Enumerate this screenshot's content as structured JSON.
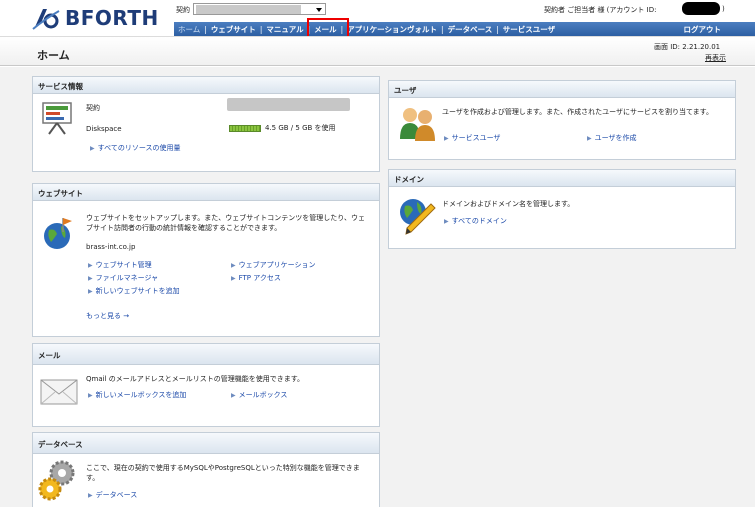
{
  "header": {
    "brand": "BFORTH",
    "contract_label": "契約",
    "account_info": "契約者 ご担当者 様 (アカウント ID:",
    "account_close": ")"
  },
  "nav": {
    "items": [
      {
        "label": "ホーム"
      },
      {
        "label": "ウェブサイト"
      },
      {
        "label": "マニュアル"
      },
      {
        "label": "メール"
      },
      {
        "label": "アプリケーションヴォルト"
      },
      {
        "label": "データベース"
      },
      {
        "label": "サービスユーザ"
      }
    ],
    "logout": "ログアウト",
    "highlighted": "メール"
  },
  "title": {
    "page_title": "ホーム",
    "screen_id": "画面 ID: 2.21.20.01",
    "redisplay": "再表示"
  },
  "service_info": {
    "heading": "サービス情報",
    "contract_label": "契約",
    "diskspace_label": "Diskspace",
    "disk_usage": "4.5 GB / 5 GB を使用",
    "link_all": "すべてのリソースの使用量"
  },
  "website": {
    "heading": "ウェブサイト",
    "desc": "ウェブサイトをセットアップします。また、ウェブサイトコンテンツを管理したり、ウェブサイト訪問者の行動の統計情報を確認することができます。",
    "domain": "brass-int.co.jp",
    "links": {
      "manage": "ウェブサイト管理",
      "filemanager": "ファイルマネージャ",
      "add_site": "新しいウェブサイトを追加",
      "webapps": "ウェブアプリケーション",
      "ftp": "FTP アクセス"
    },
    "more": "もっと見る →"
  },
  "mail": {
    "heading": "メール",
    "desc": "Qmail のメールアドレスとメールリストの管理機能を使用できます。",
    "link_add": "新しいメールボックスを追加",
    "link_box": "メールボックス"
  },
  "database": {
    "heading": "データベース",
    "desc": "ここで、現在の契約で使用するMySQLやPostgreSQLといった特別な機能を管理できます。",
    "link": "データベース"
  },
  "users": {
    "heading": "ユーザ",
    "desc": "ユーザを作成および管理します。また、作成されたユーザにサービスを割り当てます。",
    "link_service_user": "サービスユーザ",
    "link_create": "ユーザを作成"
  },
  "domain": {
    "heading": "ドメイン",
    "desc": "ドメインおよびドメイン名を管理します。",
    "link_all": "すべてのドメイン"
  }
}
